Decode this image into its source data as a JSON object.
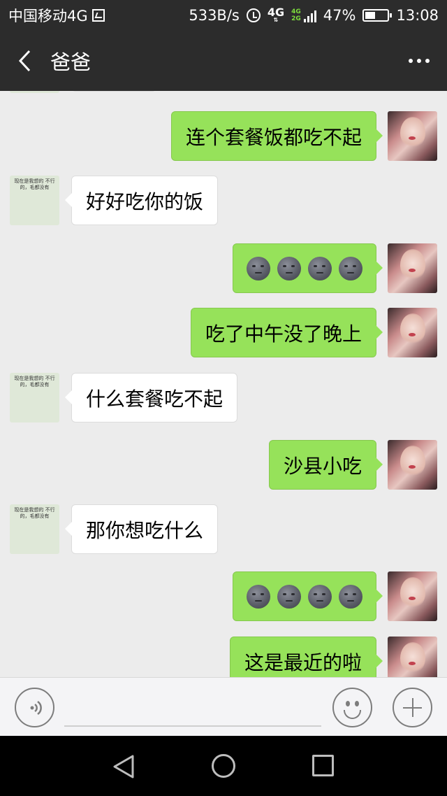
{
  "status_bar": {
    "carrier": "中国移动4G",
    "speed": "533B/s",
    "network": "4G",
    "network_secondary": [
      "4G",
      "2G"
    ],
    "battery": "47%",
    "time": "13:08"
  },
  "header": {
    "title": "爸爸",
    "back_icon": "chevron-left-icon",
    "more_icon": "more-dots-icon"
  },
  "messages": [
    {
      "from": "me",
      "text": "连个套餐饭都吃不起"
    },
    {
      "from": "dad",
      "text": "好好吃你的饭"
    },
    {
      "from": "me",
      "text": "",
      "emoji": [
        "new-moon-face",
        "new-moon-face",
        "new-moon-face",
        "new-moon-face"
      ]
    },
    {
      "from": "me",
      "text": "吃了中午没了晚上"
    },
    {
      "from": "dad",
      "text": "什么套餐吃不起"
    },
    {
      "from": "me",
      "text": "沙县小吃"
    },
    {
      "from": "dad",
      "text": "那你想吃什么"
    },
    {
      "from": "me",
      "text": "",
      "emoji": [
        "new-moon-face",
        "new-moon-face",
        "new-moon-face",
        "new-moon-face"
      ]
    },
    {
      "from": "me",
      "text": "这是最近的啦"
    }
  ],
  "dad_avatar_caption": "现在是我想的 不行的，毛都没有",
  "input_bar": {
    "voice_icon": "voice-icon",
    "emoji_icon": "smiley-icon",
    "plus_icon": "plus-icon",
    "placeholder": ""
  },
  "colors": {
    "header_bg": "#2c2c2c",
    "chat_bg": "#ececec",
    "outgoing_bubble": "#96e25a",
    "incoming_bubble": "#ffffff"
  }
}
